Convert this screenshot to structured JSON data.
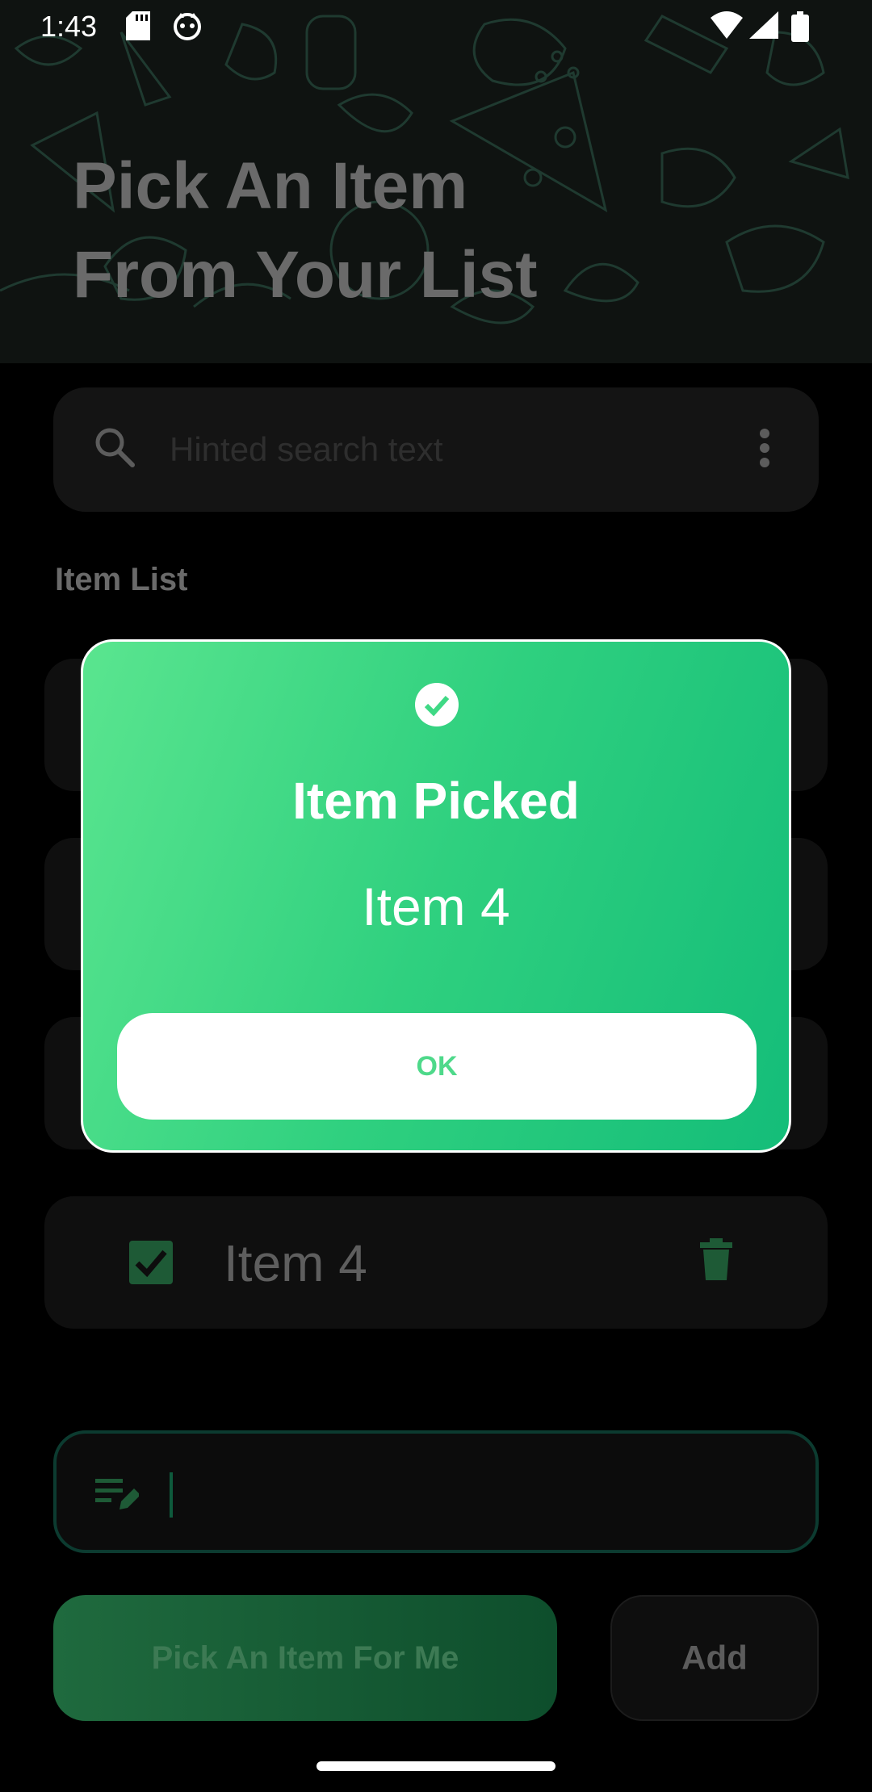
{
  "status_bar": {
    "time": "1:43",
    "icons": [
      "sd-card-icon",
      "cat-face-icon",
      "wifi-icon",
      "signal-icon",
      "battery-icon"
    ]
  },
  "header": {
    "title_line1": "Pick An Item",
    "title_line2": "From Your List"
  },
  "search": {
    "placeholder": "Hinted search text",
    "value": ""
  },
  "list": {
    "label": "Item List",
    "items": [
      {
        "label": "Item 4",
        "checked": true
      }
    ]
  },
  "entry": {
    "value": ""
  },
  "actions": {
    "pick_label": "Pick An Item For Me",
    "add_label": "Add"
  },
  "dialog": {
    "title": "Item Picked",
    "message": "Item 4",
    "ok_label": "OK"
  },
  "colors": {
    "accent_green": "#2fd07f",
    "dialog_gradient_start": "#5ae58f",
    "dialog_gradient_end": "#14bd79",
    "background": "#000000"
  }
}
